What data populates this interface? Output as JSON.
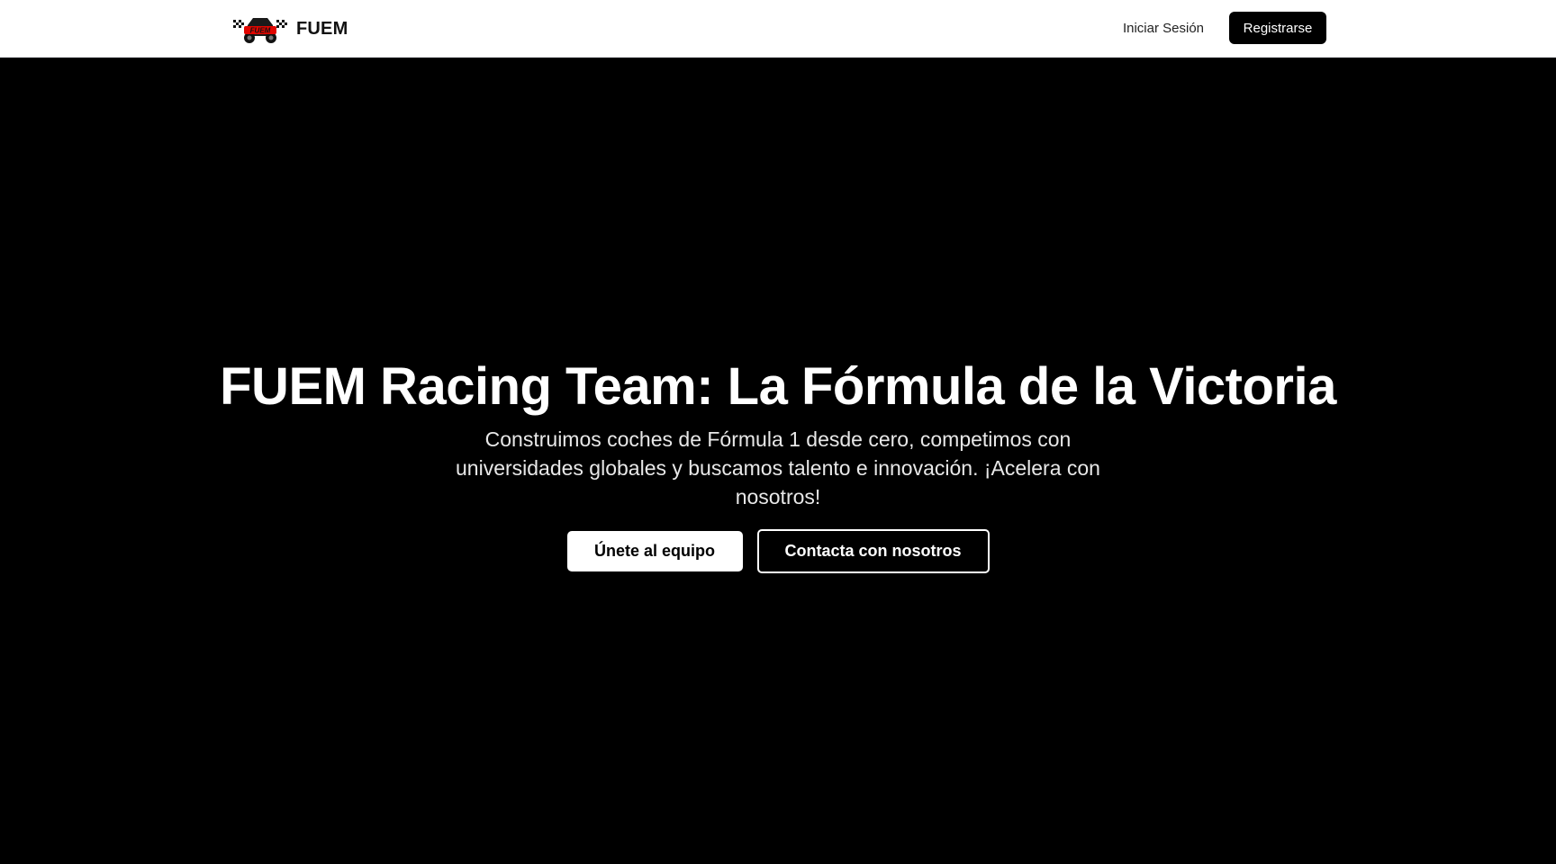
{
  "header": {
    "brand_name": "FUEM",
    "logo_icon": "racing-car-logo-icon",
    "logo_text": "FUEM",
    "login_label": "Iniciar Sesión",
    "register_label": "Registrarse"
  },
  "hero": {
    "title": "FUEM Racing Team: La Fórmula de la Victoria",
    "subtitle": "Construimos coches de Fórmula 1 desde cero, competimos con universidades globales y buscamos talento e innovación. ¡Acelera con nosotros!",
    "primary_cta": "Únete al equipo",
    "secondary_cta": "Contacta con nosotros"
  },
  "colors": {
    "hero_background": "#000000",
    "header_background": "#ffffff",
    "accent": "#e10600"
  }
}
